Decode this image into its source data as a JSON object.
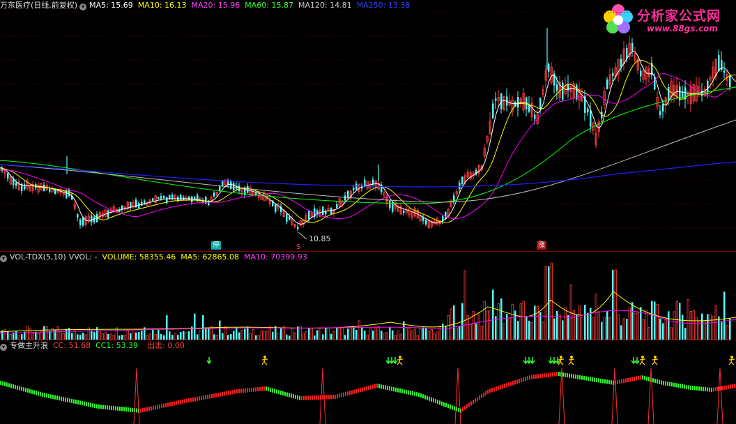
{
  "main": {
    "stock_title": "万东医疗(日线,前复权)",
    "ma5": "MA5: 15.69",
    "ma10": "MA10: 16.13",
    "ma20": "MA20: 15.96",
    "ma60": "MA60: 15.87",
    "ma120": "MA120: 14.81",
    "ma250": "MA250: 13.38",
    "low_label": "10.85",
    "tag_ting": "停",
    "tag_s": "S",
    "tag_zhang": "涨"
  },
  "volume": {
    "name": "VOL-TDX(5,10)",
    "vvol": "VVOL: -",
    "volume": "VOLUME: 58355.46",
    "ma5": "MA5: 62865.08",
    "ma10": "MA10: 70399.93"
  },
  "indicator": {
    "name": "专做主升浪",
    "cc": "CC: 51.68",
    "cc1": "CC1: 53.39",
    "chuji": "出击: 0.00"
  },
  "logo": {
    "main": "分析家公式网",
    "sub": "www.88gs.com"
  },
  "colors": {
    "up": "#ff3c3c",
    "down": "#54ffff",
    "ma5": "#ffffff",
    "ma10": "#ffff00",
    "ma20": "#ff00ff",
    "ma60": "#00ff00",
    "ma120": "#c0c0c0",
    "ma250": "#2020ff"
  },
  "icons": [
    "dropdown-icon",
    "flower-logo-icon",
    "down-arrow-signal-icon",
    "runner-signal-icon"
  ]
}
